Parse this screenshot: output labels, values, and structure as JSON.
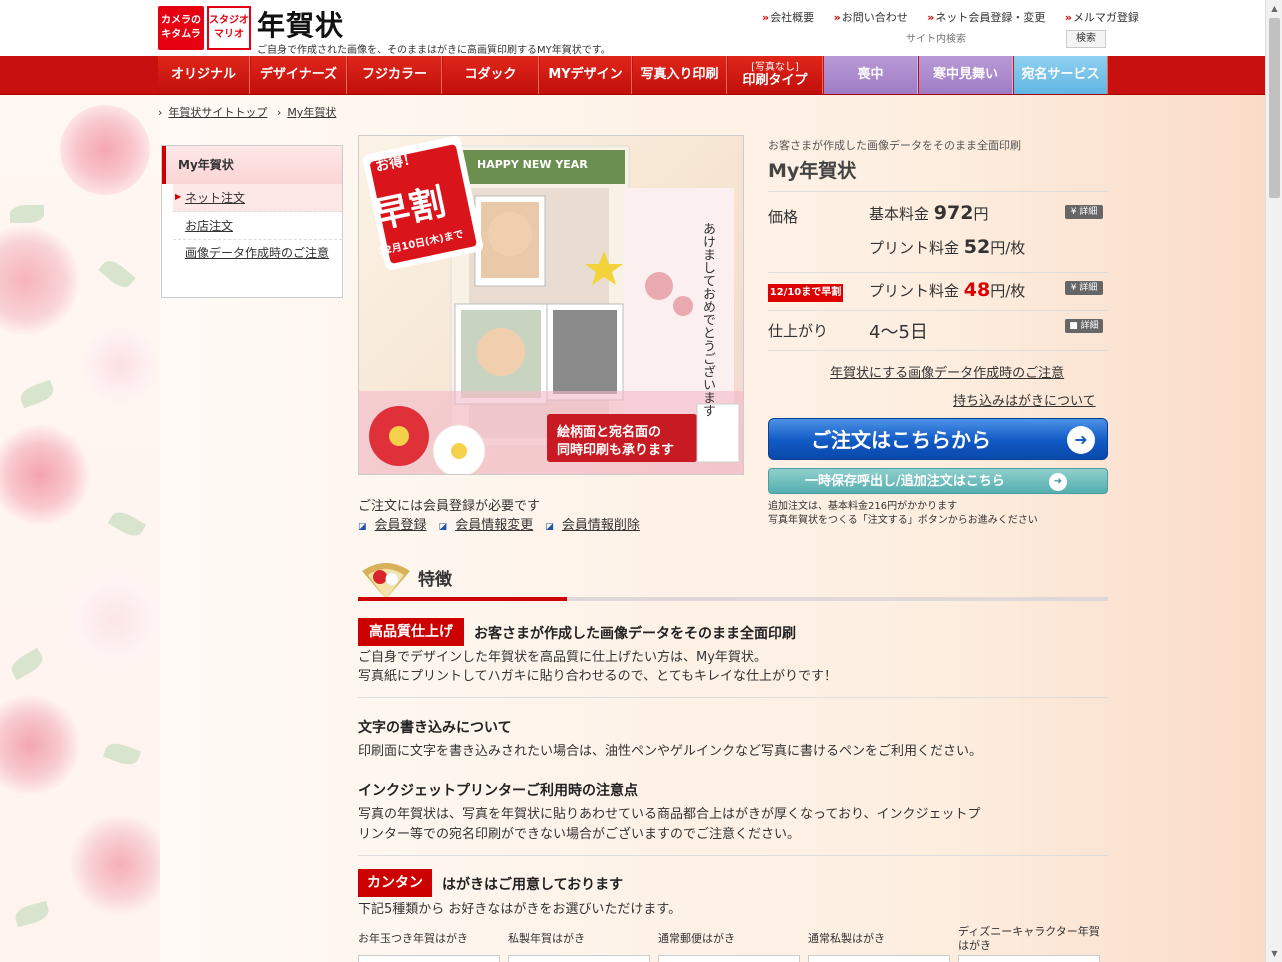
{
  "header": {
    "logo1": "カメラのキタムラ",
    "logo2": "スタジオマリオ",
    "title": "年賀状",
    "subtitle": "ご自身で作成された画像を、そのままはがきに高画質印刷するMY年賀状です。",
    "links": [
      "会社概要",
      "お問い合わせ",
      "ネット会員登録・変更",
      "メルマガ登録"
    ],
    "search_placeholder": "サイト内検索",
    "search_button": "検索"
  },
  "nav": {
    "items": [
      "オリジナル",
      "デザイナーズ",
      "フジカラー",
      "コダック",
      "MYデザイン",
      "写真入り印刷"
    ],
    "print_type_small": "[写真なし]",
    "print_type": "印刷タイプ",
    "mourning": "喪中",
    "winter": "寒中見舞い",
    "address": "宛名サービス"
  },
  "breadcrumb": [
    "年賀状サイトトップ",
    "My年賀状"
  ],
  "sidebar": {
    "title": "My年賀状",
    "items": [
      "ネット注文",
      "お店注文",
      "画像データ作成時のご注意"
    ]
  },
  "hero": {
    "badge_top": "お得！",
    "badge_main": "早割",
    "badge_date": "12月10日(木)まで",
    "happy": "HAPPY NEW YEAR",
    "greeting": "あけましておめでとうございます",
    "caption_line1": "絵柄面と宛名面の",
    "caption_line2": "同時印刷も承ります"
  },
  "product": {
    "subtitle": "お客さまが作成した画像データをそのまま全面印刷",
    "title": "My年賀状",
    "price_label": "価格",
    "base_label": "基本料金",
    "base_value": "972",
    "yen": "円",
    "print_label": "プリント料金",
    "print_value": "52",
    "per_unit": "円/枚",
    "early_badge": "12/10まで早割",
    "early_value": "48",
    "finish_label": "仕上がり",
    "finish_value": "4〜5日",
    "detail": "詳細",
    "link1": "年賀状にする画像データ作成時のご注意",
    "link2": "持ち込みはがきについて",
    "order_button": "ご注文はこちらから",
    "save_button": "一時保存呼出し/追加注文はこちら",
    "note1": "追加注文は、基本料金216円がかかります",
    "note2": "写真年賀状をつくる「注文する」ボタンからお進みください"
  },
  "member": {
    "note": "ご注文には会員登録が必要です",
    "links": [
      "会員登録",
      "会員情報変更",
      "会員情報削除"
    ]
  },
  "features": {
    "title": "特徴",
    "tag1": "高品質仕上げ",
    "h1": "お客さまが作成した画像データをそのまま全面印刷",
    "p1a": "ご自身でデザインした年賀状を高品質に仕上げたい方は、My年賀状。",
    "p1b": "写真紙にプリントしてハガキに貼り合わせるので、とてもキレイな仕上がりです！",
    "h2": "文字の書き込みについて",
    "p2": "印刷面に文字を書き込みされたい場合は、油性ペンやゲルインクなど写真に書けるペンをご利用ください。",
    "h3": "インクジェットプリンターご利用時の注意点",
    "p3a": "写真の年賀状は、写真を年賀状に貼りあわせている商品都合上はがきが厚くなっており、インクジェットプ",
    "p3b": "リンター等での宛名印刷ができない場合がございますのでご注意ください。",
    "tag2": "カンタン",
    "h4": "はがきはご用意しております",
    "p4": "下記5種類から お好きなはがきをお選びいただけます。",
    "cards": [
      "お年玉つき年賀はがき",
      "私製年賀はがき",
      "通常郵便はがき",
      "通常私製はがき",
      "ディズニーキャラクター年賀はがき"
    ]
  },
  "colors": {
    "brand_red": "#c8110e",
    "order_blue": "#1059c4",
    "save_teal": "#55aeb0",
    "nav_purple": "#9f7cc5",
    "nav_blue": "#61b6e3"
  }
}
